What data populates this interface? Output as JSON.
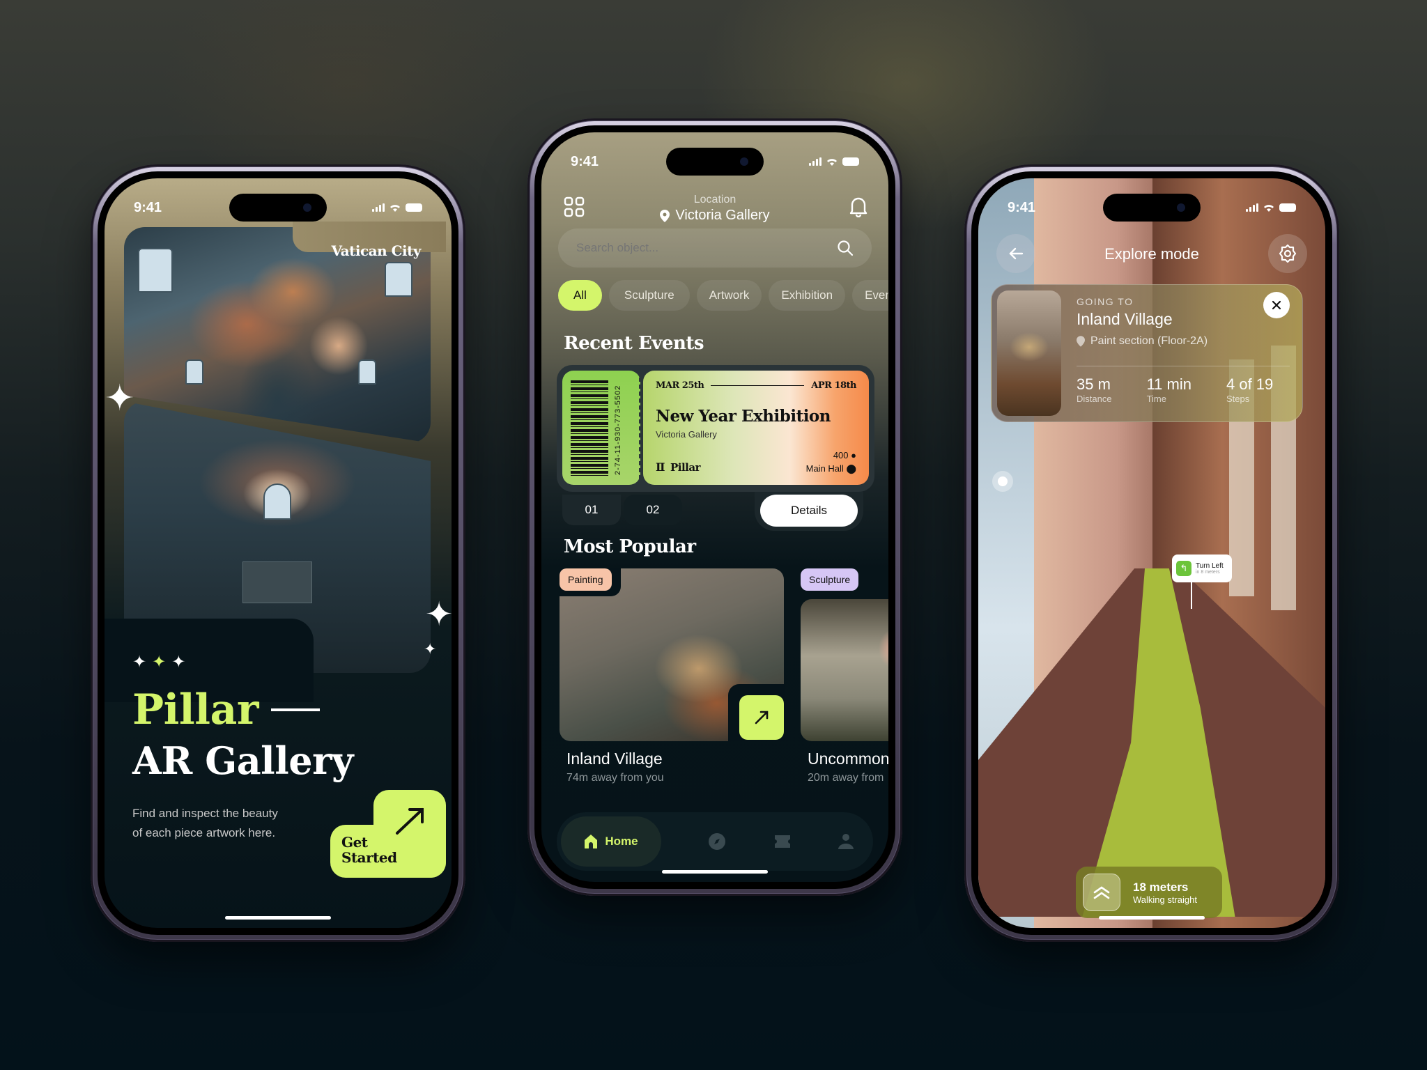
{
  "status_bar": {
    "time": "9:41"
  },
  "left_screen": {
    "location_label": "Vatican City",
    "title_line1": "Pillar",
    "title_line2": "AR Gallery",
    "description_line1": "Find and inspect the beauty",
    "description_line2": "of each piece artwork here.",
    "cta_line1": "Get",
    "cta_line2": "Started",
    "icons": {
      "cta": "arrow-up-right-icon",
      "sparkles": "sparkle-icon"
    }
  },
  "middle_screen": {
    "header": {
      "location_caption": "Location",
      "location_name": "Victoria Gallery",
      "menu_icon": "grid-icon",
      "bell_icon": "bell-icon"
    },
    "search": {
      "placeholder": "Search object..."
    },
    "categories": [
      {
        "label": "All",
        "active": true
      },
      {
        "label": "Sculpture",
        "active": false
      },
      {
        "label": "Artwork",
        "active": false
      },
      {
        "label": "Exhibition",
        "active": false
      },
      {
        "label": "Event",
        "active": false
      }
    ],
    "recent_events_title": "Recent Events",
    "ticket": {
      "code": "2-74-11-930-773-5502",
      "start_date": "MAR 25th",
      "end_date": "APR 18th",
      "title": "New Year Exhibition",
      "venue": "Victoria Gallery",
      "brand": "Pillar",
      "attendees": "400",
      "hall": "Main Hall"
    },
    "pager": [
      "01",
      "02"
    ],
    "details_label": "Details",
    "most_popular_title": "Most Popular",
    "popular": [
      {
        "tag": "Painting",
        "tag_color": "#f7c4a8",
        "name": "Inland Village",
        "distance": "74m away from you"
      },
      {
        "tag": "Sculpture",
        "tag_color": "#d6c6f5",
        "name": "Uncommon",
        "distance": "20m away from"
      }
    ],
    "nav": [
      {
        "label": "Home",
        "icon": "home-icon",
        "active": true
      },
      {
        "label": "",
        "icon": "compass-icon",
        "active": false
      },
      {
        "label": "",
        "icon": "ticket-icon",
        "active": false
      },
      {
        "label": "",
        "icon": "profile-icon",
        "active": false
      }
    ]
  },
  "right_screen": {
    "title": "Explore mode",
    "destination": {
      "caption": "GOING TO",
      "name": "Inland Village",
      "section": "Paint section (Floor-2A)",
      "stats": [
        {
          "value": "35 m",
          "label": "Distance"
        },
        {
          "value": "11 min",
          "label": "Time"
        },
        {
          "value": "4 of 19",
          "label": "Steps"
        }
      ]
    },
    "turn_sign": {
      "title": "Turn Left",
      "subtitle": "in 8 meters"
    },
    "walking": {
      "distance": "18 meters",
      "instruction": "Walking straight"
    }
  },
  "colors": {
    "accent": "#d4f56b",
    "background": "#03121a",
    "ticket_green": "#8fd14f",
    "ticket_orange": "#f58a4a"
  }
}
